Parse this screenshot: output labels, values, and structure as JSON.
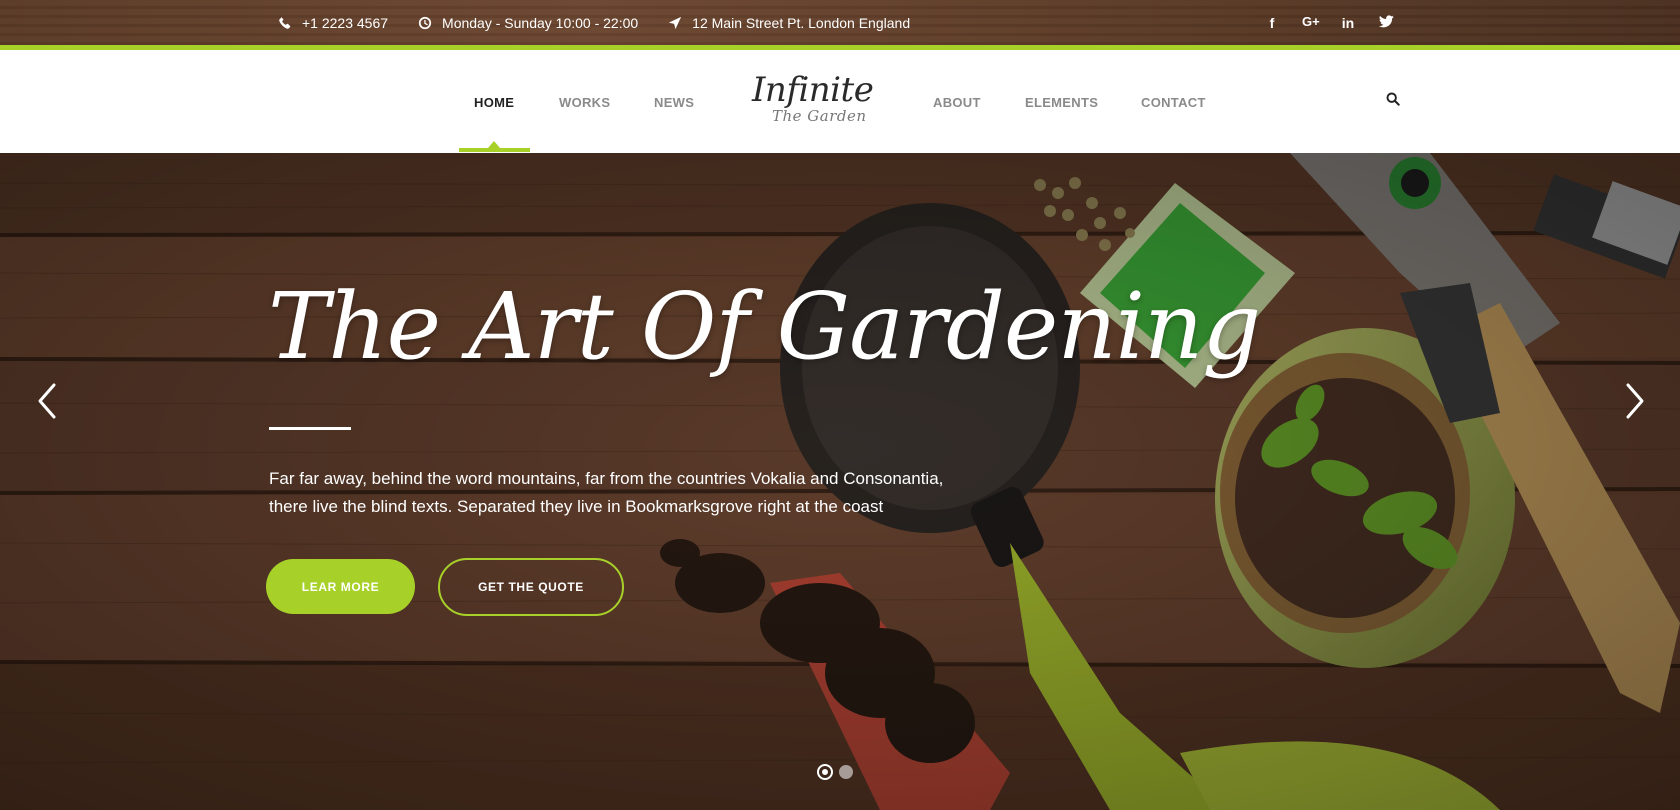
{
  "topbar": {
    "phone": "+1 2223 4567",
    "hours": "Monday - Sunday 10:00 - 22:00",
    "address": "12 Main Street Pt. London England",
    "social": [
      {
        "name": "facebook-icon",
        "glyph": "f"
      },
      {
        "name": "google-plus-icon",
        "glyph": "G+"
      },
      {
        "name": "linkedin-icon",
        "glyph": "in"
      },
      {
        "name": "twitter-icon",
        "glyph": "twitter"
      }
    ]
  },
  "nav": {
    "home": "HOME",
    "works": "WORKS",
    "news": "NEWS",
    "about": "ABOUT",
    "elements": "ELEMENTS",
    "contact": "CONTACT",
    "active": "HOME"
  },
  "logo": {
    "main": "Infinite",
    "sub": "The Garden"
  },
  "hero": {
    "title": "The Art Of Gardening",
    "text_line1": "Far far away, behind the word mountains, far from the countries Vokalia and Consonantia,",
    "text_line2": "there live the blind texts. Separated they live in Bookmarksgrove right at the coast",
    "primary_button": "LEAR MORE",
    "secondary_button": "GET THE QUOTE",
    "slide_count": 2,
    "active_slide": 1
  },
  "colors": {
    "accent": "#a7d129",
    "nav_active": "#222222",
    "nav_inactive": "#8a8a8a"
  }
}
